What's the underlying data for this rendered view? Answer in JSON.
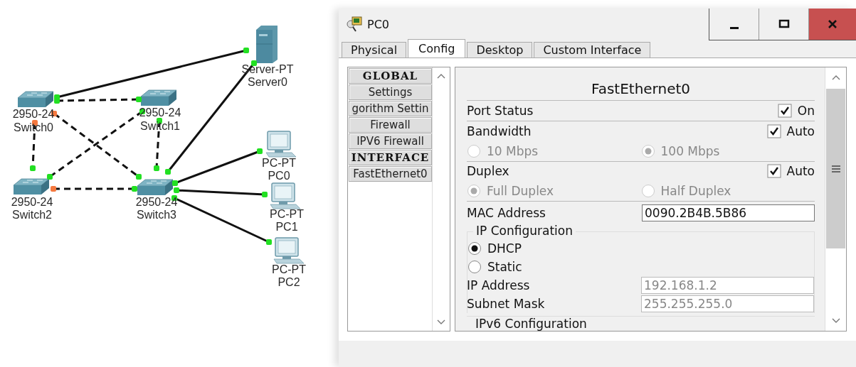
{
  "topology": {
    "nodes": [
      {
        "kind": "server",
        "model": "Server-PT",
        "name": "Server0"
      },
      {
        "kind": "switch",
        "model": "2950-24",
        "name": "Switch0"
      },
      {
        "kind": "switch",
        "model": "2950-24",
        "name": "Switch1"
      },
      {
        "kind": "switch",
        "model": "2950-24",
        "name": "Switch2"
      },
      {
        "kind": "switch",
        "model": "2950-24",
        "name": "Switch3"
      },
      {
        "kind": "pc",
        "model": "PC-PT",
        "name": "PC0"
      },
      {
        "kind": "pc",
        "model": "PC-PT",
        "name": "PC1"
      },
      {
        "kind": "pc",
        "model": "PC-PT",
        "name": "PC2"
      }
    ],
    "links": [
      {
        "kind": "straight",
        "ends": [
          {
            "blocked": false
          },
          {
            "blocked": false
          }
        ]
      },
      {
        "kind": "crossover",
        "ends": [
          {
            "blocked": false
          },
          {
            "blocked": false
          }
        ]
      },
      {
        "kind": "crossover",
        "ends": [
          {
            "blocked": true
          },
          {
            "blocked": false
          }
        ]
      },
      {
        "kind": "crossover",
        "ends": [
          {
            "blocked": true
          },
          {
            "blocked": false
          }
        ]
      },
      {
        "kind": "crossover",
        "ends": [
          {
            "blocked": false
          },
          {
            "blocked": false
          }
        ]
      },
      {
        "kind": "crossover",
        "ends": [
          {
            "blocked": false
          },
          {
            "blocked": false
          }
        ]
      },
      {
        "kind": "crossover",
        "ends": [
          {
            "blocked": true
          },
          {
            "blocked": false
          }
        ]
      },
      {
        "kind": "straight",
        "ends": [
          {
            "blocked": false
          },
          {
            "blocked": false
          }
        ]
      },
      {
        "kind": "straight",
        "ends": [
          {
            "blocked": false
          },
          {
            "blocked": false
          }
        ]
      },
      {
        "kind": "straight",
        "ends": [
          {
            "blocked": false
          },
          {
            "blocked": false
          }
        ]
      },
      {
        "kind": "straight",
        "ends": [
          {
            "blocked": false
          },
          {
            "blocked": false
          }
        ]
      }
    ]
  },
  "window": {
    "title": "PC0",
    "controls": [
      {
        "kind": "minimize"
      },
      {
        "kind": "maximize"
      },
      {
        "kind": "close"
      }
    ]
  },
  "tabs": [
    {
      "label": "Physical",
      "selected": false
    },
    {
      "label": "Config",
      "selected": true
    },
    {
      "label": "Desktop",
      "selected": false
    },
    {
      "label": "Custom Interface",
      "selected": false
    }
  ],
  "sidebar": {
    "items": [
      {
        "label": "GLOBAL",
        "kind": "header"
      },
      {
        "label": "Settings",
        "kind": "item"
      },
      {
        "label": "gorithm Settin",
        "kind": "item"
      },
      {
        "label": "Firewall",
        "kind": "item"
      },
      {
        "label": "IPV6 Firewall",
        "kind": "item"
      },
      {
        "label": "INTERFACE",
        "kind": "header"
      },
      {
        "label": "FastEthernet0",
        "kind": "item"
      }
    ]
  },
  "interface": {
    "title": "FastEthernet0",
    "port_status": {
      "label": "Port Status",
      "option": "On",
      "checked": true
    },
    "bandwidth": {
      "label": "Bandwidth",
      "option": "Auto",
      "checked": true,
      "choices": [
        {
          "label": "10 Mbps",
          "selected": false
        },
        {
          "label": "100 Mbps",
          "selected": true
        }
      ]
    },
    "duplex": {
      "label": "Duplex",
      "option": "Auto",
      "checked": true,
      "choices": [
        {
          "label": "Full Duplex",
          "selected": true
        },
        {
          "label": "Half Duplex",
          "selected": false
        }
      ]
    },
    "mac_address": {
      "label": "MAC Address",
      "value": "0090.2B4B.5B86"
    },
    "ip_configuration": {
      "title": "IP Configuration",
      "modes": [
        {
          "label": "DHCP",
          "selected": true
        },
        {
          "label": "Static",
          "selected": false
        }
      ],
      "fields": [
        {
          "label": "IP Address",
          "value": "192.168.1.2",
          "disabled": true
        },
        {
          "label": "Subnet Mask",
          "value": "255.255.255.0",
          "disabled": true
        }
      ]
    },
    "ipv6_configuration": {
      "title": "IPv6 Configuration"
    }
  }
}
